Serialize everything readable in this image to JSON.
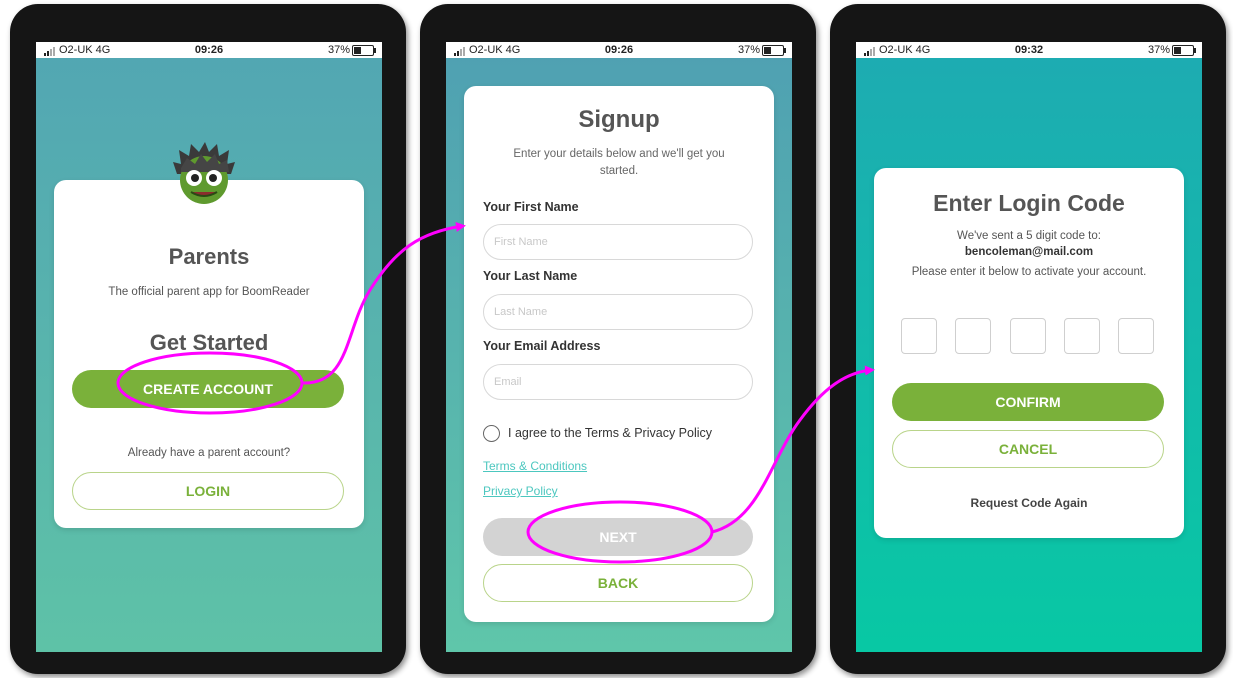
{
  "status": {
    "carrier": "O2-UK 4G",
    "battery": "37%",
    "times": [
      "09:26",
      "09:26",
      "09:32"
    ]
  },
  "screen1": {
    "title": "Parents",
    "subtitle": "The official parent app for BoomReader",
    "get_started": "Get Started",
    "create_account": "CREATE ACCOUNT",
    "already": "Already have a parent account?",
    "login": "LOGIN"
  },
  "screen2": {
    "title": "Signup",
    "subtitle": "Enter your details below and we'll get you started.",
    "first_name_label": "Your First Name",
    "first_name_placeholder": "First Name",
    "last_name_label": "Your Last Name",
    "last_name_placeholder": "Last Name",
    "email_label": "Your Email Address",
    "email_placeholder": "Email",
    "agree": "I agree to the Terms & Privacy Policy",
    "terms_link": "Terms & Conditions",
    "privacy_link": "Privacy Policy",
    "next": "NEXT",
    "back": "BACK"
  },
  "screen3": {
    "title": "Enter Login Code",
    "sent_line": "We've sent a 5 digit code to:",
    "email": "bencoleman@mail.com",
    "instruction": "Please enter it below to activate your account.",
    "confirm": "CONFIRM",
    "cancel": "CANCEL",
    "request_again": "Request Code Again"
  },
  "colors": {
    "accent_green": "#7ab13a",
    "annotation_magenta": "#ff00ff",
    "link_teal": "#4cc7bf"
  },
  "icons": [
    "signal-icon",
    "battery-icon",
    "monster-mascot-icon",
    "radio-unchecked-icon"
  ]
}
